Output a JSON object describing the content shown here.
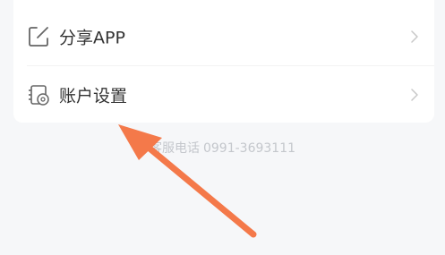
{
  "menu": {
    "items": [
      {
        "label": "分享APP",
        "icon": "share-square-icon"
      },
      {
        "label": "账户设置",
        "icon": "account-settings-icon"
      }
    ]
  },
  "footer": {
    "service_label": "客服电话",
    "service_phone": "0991-3693111"
  },
  "colors": {
    "page_bg": "#f6f7f9",
    "card_bg": "#ffffff",
    "text": "#333333",
    "icon": "#666666",
    "chevron": "#c8c8c8",
    "service_text": "#c4c7cc",
    "annotation_arrow": "#f4794a"
  }
}
